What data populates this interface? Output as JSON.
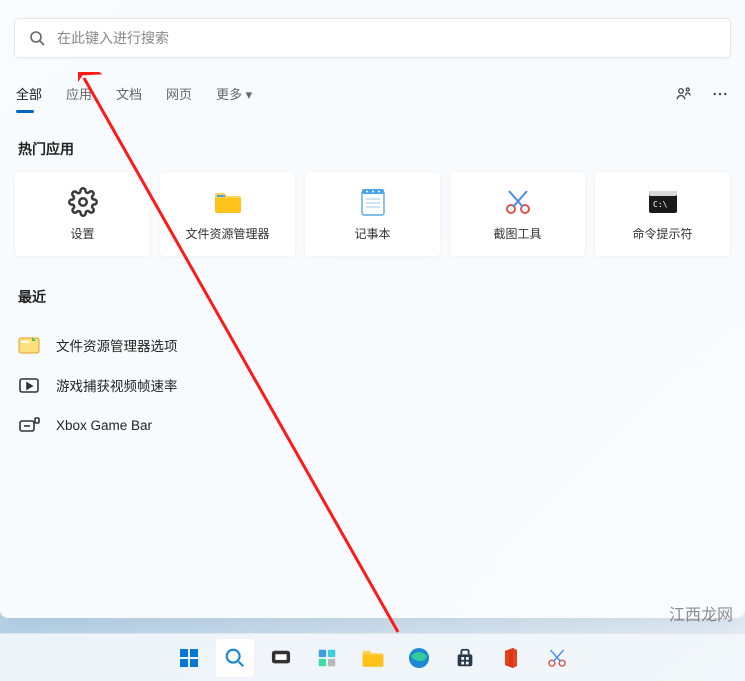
{
  "search": {
    "placeholder": "在此键入进行搜索"
  },
  "tabs": [
    {
      "label": "全部",
      "active": true
    },
    {
      "label": "应用",
      "active": false
    },
    {
      "label": "文档",
      "active": false
    },
    {
      "label": "网页",
      "active": false
    },
    {
      "label": "更多 ▾",
      "active": false
    }
  ],
  "sections": {
    "top_apps_title": "热门应用",
    "recent_title": "最近"
  },
  "top_apps": [
    {
      "label": "设置",
      "icon": "settings"
    },
    {
      "label": "文件资源管理器",
      "icon": "folder"
    },
    {
      "label": "记事本",
      "icon": "notepad"
    },
    {
      "label": "截图工具",
      "icon": "snip"
    },
    {
      "label": "命令提示符",
      "icon": "cmd"
    }
  ],
  "recent": [
    {
      "label": "文件资源管理器选项",
      "icon": "folder-options"
    },
    {
      "label": "游戏捕获视频帧速率",
      "icon": "game-capture"
    },
    {
      "label": "Xbox Game Bar",
      "icon": "xbox-bar"
    }
  ],
  "taskbar": [
    {
      "name": "start",
      "active": false
    },
    {
      "name": "search",
      "active": true
    },
    {
      "name": "taskview",
      "active": false
    },
    {
      "name": "widgets",
      "active": false
    },
    {
      "name": "explorer",
      "active": false
    },
    {
      "name": "edge",
      "active": false
    },
    {
      "name": "store",
      "active": false
    },
    {
      "name": "office",
      "active": false
    },
    {
      "name": "snip",
      "active": false
    }
  ],
  "watermark": "江西龙网"
}
